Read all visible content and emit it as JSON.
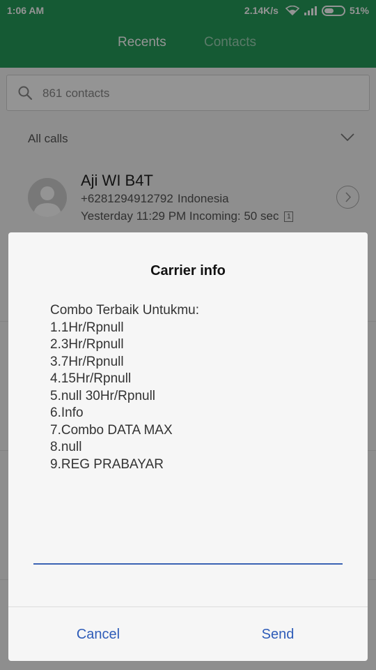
{
  "status_bar": {
    "time": "1:06 AM",
    "network_speed": "2.14K/s",
    "battery_percent": "51%",
    "battery_level": 0.51
  },
  "tabs": [
    {
      "label": "Recents",
      "active": true
    },
    {
      "label": "Contacts",
      "active": false
    }
  ],
  "search": {
    "placeholder": "861 contacts"
  },
  "filter": {
    "label": "All calls"
  },
  "recent_call": {
    "name": "Aji WI B4T",
    "number": "+6281294912792",
    "location": "Indonesia",
    "detail": "Yesterday 11:29 PM Incoming: 50 sec",
    "sim": "1"
  },
  "dialog": {
    "title": "Carrier info",
    "lines": [
      "Combo Terbaik Untukmu:",
      "1.1Hr/Rpnull",
      "2.3Hr/Rpnull",
      "3.7Hr/Rpnull",
      "4.15Hr/Rpnull",
      "5.null 30Hr/Rpnull",
      "6.Info",
      "7.Combo DATA MAX",
      "8.null",
      "9.REG PRABAYAR"
    ],
    "input_value": "",
    "cancel_label": "Cancel",
    "send_label": "Send"
  },
  "colors": {
    "header": "#259b5a",
    "accent": "#2e5cb8",
    "input_underline": "#3b63b4"
  }
}
